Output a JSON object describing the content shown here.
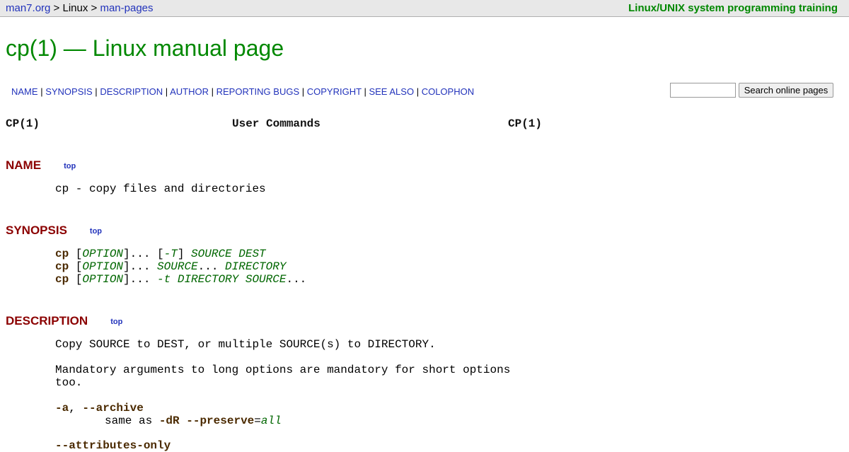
{
  "topbar": {
    "site": "man7.org",
    "sep": ">",
    "linux": "Linux",
    "manpages": "man-pages",
    "training": "Linux/UNIX system programming training"
  },
  "title": "cp(1) — Linux manual page",
  "sections_nav": [
    "NAME",
    "SYNOPSIS",
    "DESCRIPTION",
    "AUTHOR",
    "REPORTING BUGS",
    "COPYRIGHT",
    "SEE ALSO",
    "COLOPHON"
  ],
  "nav_separator": "|",
  "search": {
    "value": "",
    "button_label": "Search online pages"
  },
  "header": {
    "left": "CP(1)",
    "center": "User Commands",
    "right": "CP(1)"
  },
  "top_link": "top",
  "name": {
    "heading": "NAME",
    "text": "cp - copy files and directories"
  },
  "synopsis": {
    "heading": "SYNOPSIS",
    "cmd": "cp",
    "option": "OPTION",
    "line1": {
      "t_flag": "-T",
      "args": "SOURCE DEST"
    },
    "line2": {
      "src": "SOURCE",
      "dir": "DIRECTORY"
    },
    "line3": {
      "args": "-t DIRECTORY SOURCE"
    }
  },
  "description": {
    "heading": "DESCRIPTION",
    "p1": "Copy SOURCE to DEST, or multiple SOURCE(s) to DIRECTORY.",
    "p2a": "Mandatory arguments to long options are mandatory for short options",
    "p2b": "too.",
    "opt_a_short": "-a",
    "opt_a_long": "--archive",
    "same_as": "same as",
    "dR": "-dR",
    "preserve": "--preserve",
    "all": "all",
    "next_opt": "--attributes-only"
  },
  "colors": {
    "link": "#2233bb",
    "title": "#008800",
    "section": "#8b0000",
    "option": "#4b2a00",
    "arg": "#006600"
  }
}
